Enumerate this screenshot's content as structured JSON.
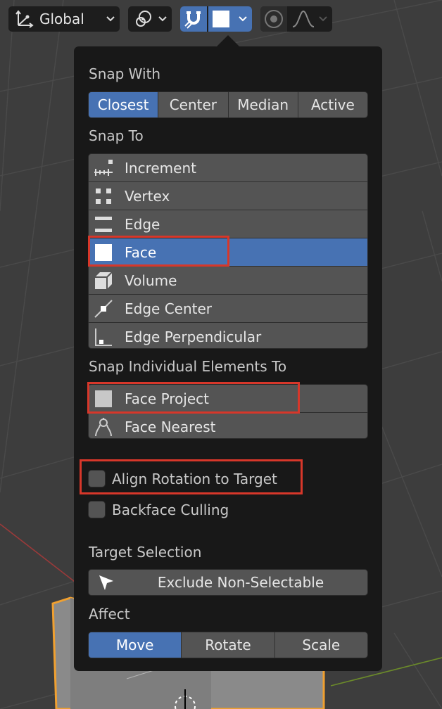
{
  "header": {
    "orientation_label": "Global"
  },
  "snap_with": {
    "title": "Snap With",
    "options": [
      "Closest",
      "Center",
      "Median",
      "Active"
    ],
    "selected": "Closest"
  },
  "snap_to": {
    "title": "Snap To",
    "items": [
      {
        "label": "Increment",
        "icon": "increment-icon"
      },
      {
        "label": "Vertex",
        "icon": "vertex-icon"
      },
      {
        "label": "Edge",
        "icon": "edge-icon"
      },
      {
        "label": "Face",
        "icon": "face-icon"
      },
      {
        "label": "Volume",
        "icon": "volume-icon"
      },
      {
        "label": "Edge Center",
        "icon": "edge-center-icon"
      },
      {
        "label": "Edge Perpendicular",
        "icon": "edge-perpendicular-icon"
      }
    ],
    "selected": "Face"
  },
  "snap_individual": {
    "title": "Snap Individual Elements To",
    "items": [
      {
        "label": "Face Project",
        "icon": "face-project-icon"
      },
      {
        "label": "Face Nearest",
        "icon": "face-nearest-icon"
      }
    ]
  },
  "options": {
    "align_rotation": {
      "label": "Align Rotation to Target",
      "checked": false
    },
    "backface_culling": {
      "label": "Backface Culling",
      "checked": false
    }
  },
  "target_selection": {
    "title": "Target Selection",
    "button_label": "Exclude Non-Selectable"
  },
  "affect": {
    "title": "Affect",
    "options": [
      "Move",
      "Rotate",
      "Scale"
    ],
    "selected": "Move"
  },
  "colors": {
    "accent": "#4772b3",
    "highlight": "#d7372a",
    "selection_outline": "#f0a030"
  }
}
